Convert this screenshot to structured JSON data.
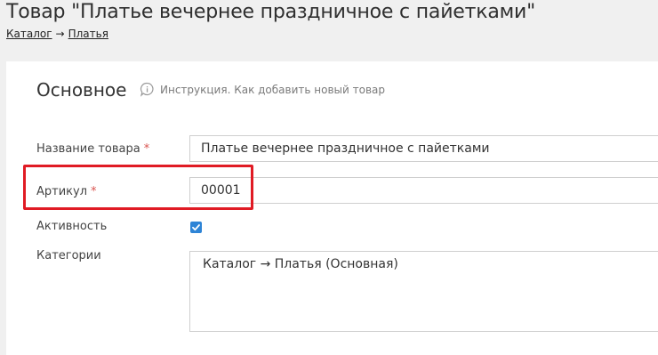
{
  "header": {
    "title": "Товар \"Платье вечернее праздничное с пайетками\"",
    "breadcrumb": {
      "items": [
        "Каталог",
        "Платья"
      ],
      "separator": "→"
    }
  },
  "section": {
    "title": "Основное",
    "help_icon": "info-speech-bubble-icon",
    "help_text": "Инструкция. Как добавить новый товар"
  },
  "form": {
    "name": {
      "label": "Название товара",
      "required_mark": "*",
      "value": "Платье вечернее праздничное с пайетками"
    },
    "sku": {
      "label": "Артикул",
      "required_mark": "*",
      "value": "00001"
    },
    "active": {
      "label": "Активность",
      "checked": true
    },
    "categories": {
      "label": "Категории",
      "value": "Каталог → Платья (Основная)"
    }
  },
  "colors": {
    "checkbox_accent": "#2e84d6",
    "required_mark": "#d9534f",
    "highlight": "#e01b24"
  }
}
